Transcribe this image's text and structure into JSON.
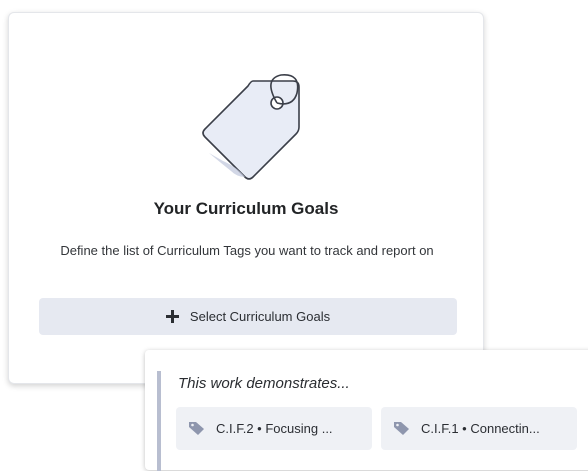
{
  "card": {
    "illustration_icon": "price-tag-icon",
    "title": "Your Curriculum Goals",
    "description": "Define the list of Curriculum Tags you want to track and report on",
    "button": {
      "label": "Select Curriculum Goals",
      "icon": "plus-icon"
    }
  },
  "panel": {
    "heading": "This work demonstrates...",
    "chips": [
      {
        "label": "C.I.F.2 • Focusing ...",
        "icon": "tag-icon"
      },
      {
        "label": "C.I.F.1 • Connectin...",
        "icon": "tag-icon"
      }
    ]
  },
  "colors": {
    "button_bg": "#e6e9f1",
    "chip_bg": "#eff1f5",
    "tag_icon": "#8e96ad",
    "accent_bar": "#b8bed0"
  }
}
